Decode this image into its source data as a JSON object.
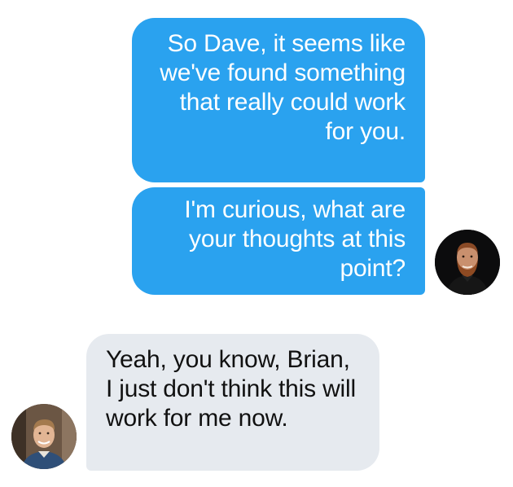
{
  "conversation": {
    "messages": [
      {
        "sender": "outgoing",
        "text": "So Dave, it seems like we've found something that really could work for you."
      },
      {
        "sender": "outgoing",
        "text": "I'm curious, what are your thoughts at this point?"
      },
      {
        "sender": "incoming",
        "text": "Yeah, you know, Brian, I just don't think this will work for me now."
      }
    ]
  },
  "colors": {
    "outgoing_bubble": "#2aa2ef",
    "incoming_bubble": "#e6eaef",
    "outgoing_text": "#ffffff",
    "incoming_text": "#111111"
  },
  "icons": {
    "outgoing_avatar": "avatar-brian",
    "incoming_avatar": "avatar-dave"
  }
}
